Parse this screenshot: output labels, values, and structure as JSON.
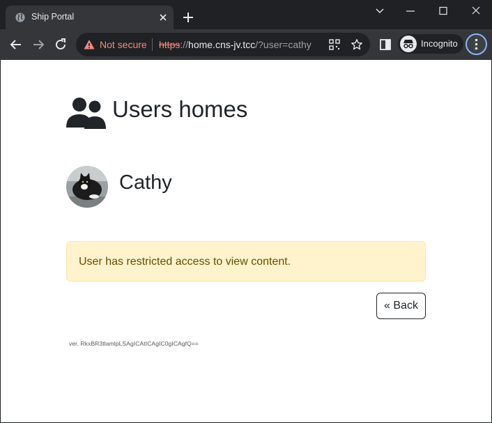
{
  "browser": {
    "tab_title": "Ship Portal",
    "security_label": "Not secure",
    "url": {
      "scheme": "https",
      "slashes": "://",
      "host": "home.cns-jv.tcc",
      "path": "/?user=cathy"
    },
    "profile_label": "Incognito",
    "colors": {
      "frame": "#202124",
      "toolbar": "#35363a",
      "insecure": "#f28b82",
      "accent": "#8ab4f8"
    }
  },
  "page": {
    "title": "Users homes",
    "user": {
      "name": "Cathy"
    },
    "alert": {
      "message": "User has restricted access to view content.",
      "background": "#fff3cd",
      "border": "#ffe69c",
      "text_color": "#664d03"
    },
    "back_button": {
      "label": "« Back"
    },
    "version": "ver. RkxBR3tlamlpLSAgICAtICAgIC0gICAgfQ=="
  }
}
